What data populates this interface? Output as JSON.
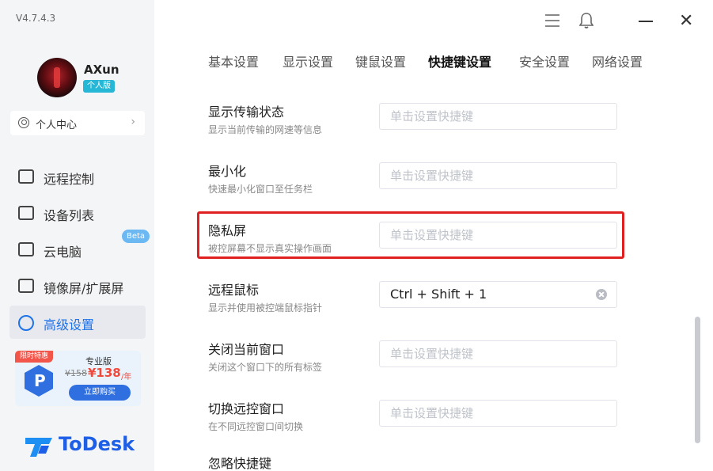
{
  "app": {
    "version": "V4.7.4.3",
    "brand": "ToDesk"
  },
  "user": {
    "name": "AXun",
    "plan_badge": "个人版",
    "personal_center": "个人中心"
  },
  "sidebar": {
    "items": [
      {
        "label": "远程控制",
        "icon": "remote-control-icon"
      },
      {
        "label": "设备列表",
        "icon": "device-list-icon"
      },
      {
        "label": "云电脑",
        "icon": "cloud-pc-icon",
        "badge": "Beta"
      },
      {
        "label": "镜像屏/扩展屏",
        "icon": "mirror-screen-icon"
      },
      {
        "label": "高级设置",
        "icon": "advanced-settings-icon",
        "active": true
      }
    ]
  },
  "promo": {
    "tag": "限时特惠",
    "title": "专业版",
    "price_old": "¥158",
    "price_new": "¥138",
    "price_unit": "/年",
    "buy_label": "立即购买"
  },
  "tabs": [
    {
      "label": "基本设置"
    },
    {
      "label": "显示设置"
    },
    {
      "label": "键鼠设置"
    },
    {
      "label": "快捷键设置",
      "active": true
    },
    {
      "label": "安全设置"
    },
    {
      "label": "网络设置"
    }
  ],
  "shortcuts": [
    {
      "title": "显示传输状态",
      "desc": "显示当前传输的网速等信息",
      "value": "",
      "placeholder": "单击设置快捷键"
    },
    {
      "title": "最小化",
      "desc": "快速最小化窗口至任务栏",
      "value": "",
      "placeholder": "单击设置快捷键"
    },
    {
      "title": "隐私屏",
      "desc": "被控屏幕不显示真实操作画面",
      "value": "",
      "placeholder": "单击设置快捷键",
      "highlighted": true
    },
    {
      "title": "远程鼠标",
      "desc": "显示并使用被控端鼠标指针",
      "value": "Ctrl + Shift + 1",
      "placeholder": "单击设置快捷键"
    },
    {
      "title": "关闭当前窗口",
      "desc": "关闭这个窗口下的所有标签",
      "value": "",
      "placeholder": "单击设置快捷键"
    },
    {
      "title": "切换远控窗口",
      "desc": "在不同远控窗口间切换",
      "value": "",
      "placeholder": "单击设置快捷键"
    },
    {
      "title": "忽略快捷键",
      "desc": "",
      "value": "",
      "placeholder": ""
    }
  ],
  "colors": {
    "accent": "#1f73e8",
    "highlight_border": "#e02020",
    "badge_cyan": "#27b7d6",
    "sidebar_bg": "#f4f5f7"
  }
}
